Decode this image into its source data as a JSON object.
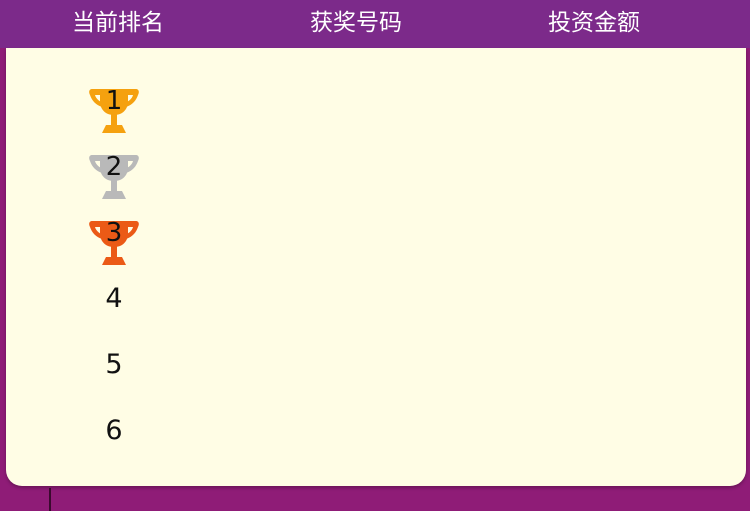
{
  "header": {
    "columns": [
      "当前排名",
      "获奖号码",
      "投资金额"
    ]
  },
  "rows": [
    {
      "rank": "1",
      "trophy": "gold-trophy-icon",
      "color": "#f5a10f"
    },
    {
      "rank": "2",
      "trophy": "silver-trophy-icon",
      "color": "#b9b9b9"
    },
    {
      "rank": "3",
      "trophy": "bronze-trophy-icon",
      "color": "#eb5a16"
    },
    {
      "rank": "4"
    },
    {
      "rank": "5"
    },
    {
      "rank": "6"
    }
  ],
  "colors": {
    "header": "#7c2a8a",
    "panel": "#fffde5",
    "background": "#8f1c77"
  }
}
